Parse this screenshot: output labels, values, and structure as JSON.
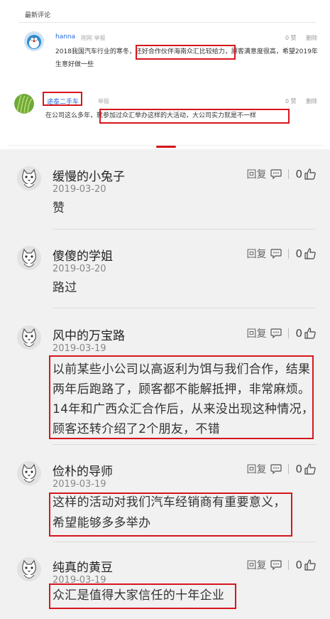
{
  "top": {
    "section_title": "最新评论",
    "comments": [
      {
        "name": "hanna",
        "meta": "刚刚 举报",
        "likes": "0 赞",
        "delete": "删除",
        "text": "2018我国汽车行业的寒冬，还好合作伙伴海南众汇比较给力，顾客满意度很高，希望2019年生意好做一些"
      },
      {
        "name": "途泰二手车",
        "meta": "举报",
        "likes": "0 赞",
        "delete": "删除",
        "text": "在公司这么多年，就参加过众汇举办这样的大活动，大公司实力就是不一样"
      }
    ]
  },
  "comments": [
    {
      "name": "缓慢的小兔子",
      "date": "2019-03-20",
      "text": "赞",
      "reply": "回复",
      "likes": "0"
    },
    {
      "name": "傻傻的学姐",
      "date": "2019-03-20",
      "text": "路过",
      "reply": "回复",
      "likes": "0"
    },
    {
      "name": "风中的万宝路",
      "date": "2019-03-19",
      "text": "以前某些小公司以高返利为饵与我们合作，结果两年后跑路了，顾客都不能解抵押，非常麻烦。14年和广西众汇合作后，从来没出现这种情况，顾客还转介绍了2个朋友，不错",
      "reply": "回复",
      "likes": "0"
    },
    {
      "name": "俭朴的导师",
      "date": "2019-03-19",
      "text": "这样的活动对我们汽车经销商有重要意义，希望能够多多举办",
      "reply": "回复",
      "likes": "0"
    },
    {
      "name": "纯真的黄豆",
      "date": "2019-03-19",
      "text": "众汇是值得大家信任的十年企业",
      "reply": "回复",
      "likes": "0"
    }
  ],
  "icons": {
    "reply": "chat-bubble-icon",
    "like": "thumbs-up-icon",
    "avatar": "cat-avatar-icon"
  },
  "colors": {
    "highlight_box": "#d6161d",
    "username_blue": "#2b6bd6",
    "tab_indicator": "#d6161d"
  }
}
